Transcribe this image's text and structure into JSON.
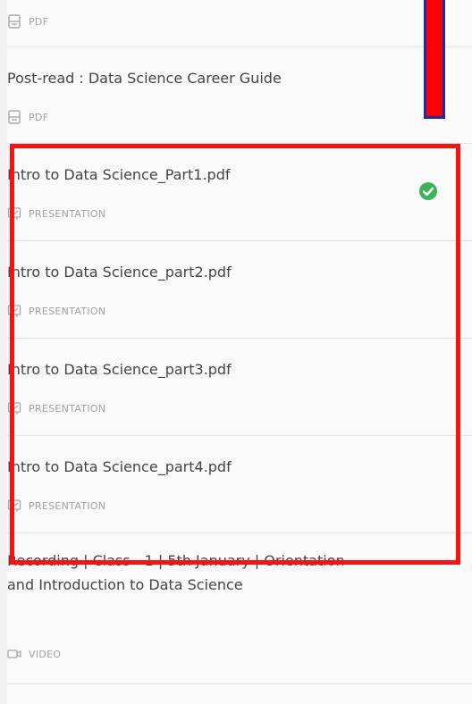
{
  "items": [
    {
      "title": "",
      "type_label": "PDF",
      "icon": "pdf-file-icon"
    },
    {
      "title": "Post-read : Data Science Career Guide",
      "type_label": "PDF",
      "icon": "pdf-file-icon"
    },
    {
      "title": "Intro to Data Science_Part1.pdf",
      "type_label": "PRESENTATION",
      "icon": "presentation-icon",
      "completed": true
    },
    {
      "title": "Intro to Data Science_part2.pdf",
      "type_label": "PRESENTATION",
      "icon": "presentation-icon"
    },
    {
      "title": "Intro to Data Science_part3.pdf",
      "type_label": "PRESENTATION",
      "icon": "presentation-icon"
    },
    {
      "title": "Intro to Data Science_part4.pdf",
      "type_label": "PRESENTATION",
      "icon": "presentation-icon"
    },
    {
      "title": "Recording | Class - 1 | 5th January | Orientation and Introduction to Data Science",
      "type_label": "VIDEO",
      "icon": "video-icon"
    }
  ],
  "colors": {
    "check_green": "#3cb35a",
    "highlight_red": "#ff0000",
    "marker_border_blue": "#1c2ba8",
    "meta_gray": "#a2a2a2"
  }
}
